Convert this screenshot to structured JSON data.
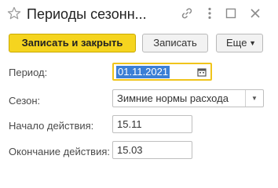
{
  "window": {
    "title": "Периоды сезонн...",
    "icons": [
      "star-icon",
      "link-icon",
      "more-vertical-icon",
      "maximize-icon",
      "close-icon"
    ]
  },
  "toolbar": {
    "save_close_label": "Записать и закрыть",
    "save_label": "Записать",
    "more_label": "Еще"
  },
  "form": {
    "period": {
      "label": "Период:",
      "value": "01.11.2021"
    },
    "season": {
      "label": "Сезон:",
      "value": "Зимние нормы расхода"
    },
    "start": {
      "label": "Начало действия:",
      "value": "15.11"
    },
    "end": {
      "label": "Окончание действия:",
      "value": "15.03"
    }
  },
  "colors": {
    "accent": "#F5D41F",
    "selection": "#3B7FD6",
    "focus_border": "#F0C41B"
  }
}
